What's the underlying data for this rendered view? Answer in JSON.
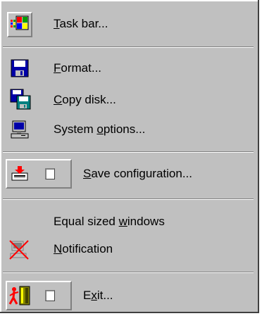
{
  "menu": {
    "items": {
      "task_bar": {
        "pre": "",
        "ul": "T",
        "post": "ask bar..."
      },
      "format": {
        "pre": "",
        "ul": "F",
        "post": "ormat..."
      },
      "copy_disk": {
        "pre": "",
        "ul": "C",
        "post": "opy disk..."
      },
      "system_options": {
        "pre": "System ",
        "ul": "o",
        "post": "ptions..."
      },
      "save_configuration": {
        "pre": "",
        "ul": "S",
        "post": "ave configuration..."
      },
      "equal_sized_windows": {
        "pre": "Equal sized ",
        "ul": "w",
        "post": "indows"
      },
      "notification": {
        "pre": "",
        "ul": "N",
        "post": "otification"
      },
      "exit": {
        "pre": "E",
        "ul": "x",
        "post": "it..."
      }
    }
  },
  "icons": {
    "task_bar": "taskbar-windows-icon",
    "format": "floppy-disk-icon",
    "copy_disk": "copy-disk-icon",
    "system_options": "computer-icon",
    "save_configuration": "save-configuration-icon",
    "notification": "notification-disabled-icon",
    "exit": "exit-door-icon"
  },
  "colors": {
    "menu_bg": "#c0c0c0",
    "shadow": "#808080",
    "highlight": "#ffffff",
    "floppy_blue": "#0000a8",
    "teal": "#008080",
    "red": "#ff0000"
  }
}
